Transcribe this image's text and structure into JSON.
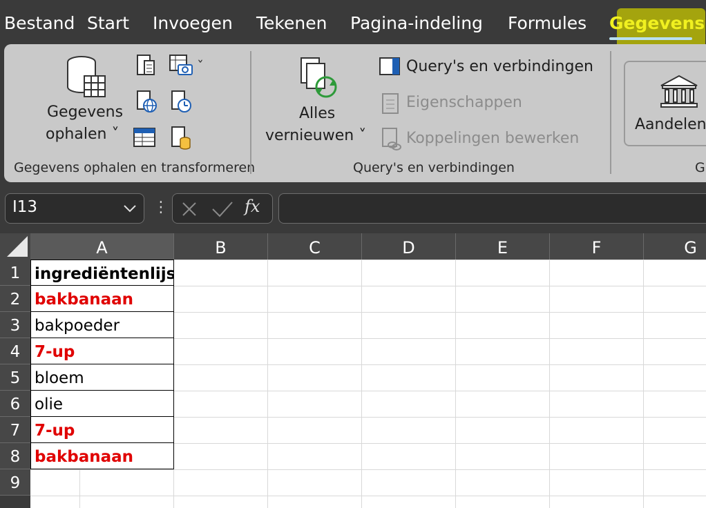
{
  "menu": {
    "tabs": [
      {
        "label": "Bestand"
      },
      {
        "label": "Start"
      },
      {
        "label": "Invoegen"
      },
      {
        "label": "Tekenen"
      },
      {
        "label": "Pagina-indeling"
      },
      {
        "label": "Formules"
      },
      {
        "label": "Gegevens",
        "active": true
      }
    ]
  },
  "ribbon": {
    "get_data": {
      "line1": "Gegevens",
      "line2": "ophalen",
      "chevron": "˅"
    },
    "group1_label": "Gegevens ophalen en transformeren",
    "refresh_all": {
      "line1": "Alles",
      "line2": "vernieuwen",
      "chevron": "˅"
    },
    "queries_connections": "Query's en verbindingen",
    "properties": "Eigenschappen",
    "edit_links": "Koppelingen bewerken",
    "group2_label": "Query's en verbindingen",
    "stocks": "Aandelen",
    "group3_label_partial": "G"
  },
  "formula_bar": {
    "name_box": "I13",
    "formula": "",
    "fx": "fx"
  },
  "grid": {
    "columns": [
      "A",
      "B",
      "C",
      "D",
      "E",
      "F",
      "G"
    ],
    "rows": [
      "1",
      "2",
      "3",
      "4",
      "5",
      "6",
      "7",
      "8",
      "9"
    ],
    "cells_a": [
      {
        "text": "ingrediëntenlijst",
        "color": "#000000",
        "bold": true
      },
      {
        "text": "bakbanaan",
        "color": "#e00000",
        "bold": true
      },
      {
        "text": "bakpoeder",
        "color": "#000000",
        "bold": false
      },
      {
        "text": "7-up",
        "color": "#e00000",
        "bold": true
      },
      {
        "text": "bloem",
        "color": "#000000",
        "bold": false
      },
      {
        "text": "olie",
        "color": "#000000",
        "bold": false
      },
      {
        "text": "7-up",
        "color": "#e00000",
        "bold": true
      },
      {
        "text": "bakbanaan",
        "color": "#e00000",
        "bold": true
      }
    ]
  },
  "colors": {
    "active_tab": "#f0f020",
    "highlight": "#c8c800",
    "duplicate_text": "#e00000"
  }
}
